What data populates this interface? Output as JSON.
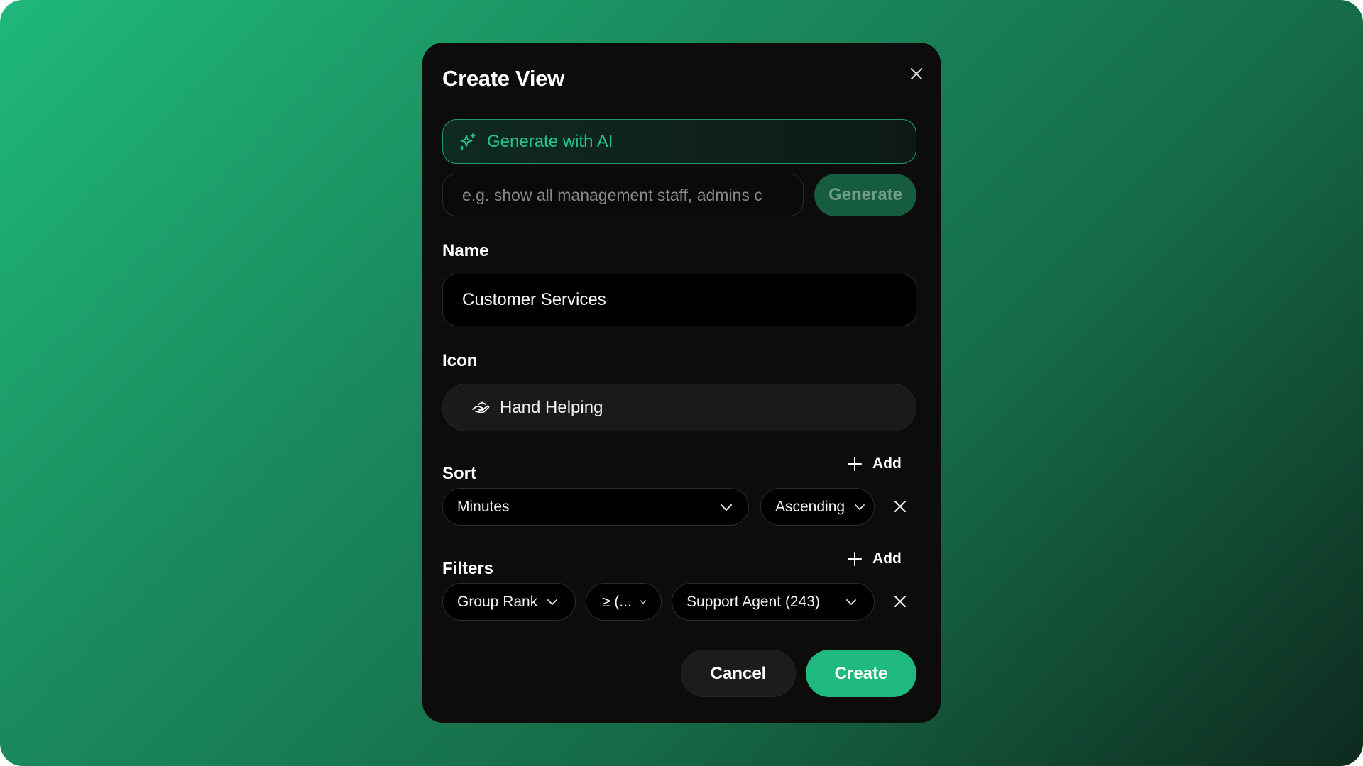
{
  "modal": {
    "title": "Create View",
    "close_icon": "x-icon"
  },
  "ai": {
    "label": "Generate with AI",
    "icon": "sparkles-icon",
    "prompt_placeholder": "e.g. show all management staff, admins c",
    "prompt_value": "",
    "generate_label": "Generate"
  },
  "name": {
    "label": "Name",
    "value": "Customer Services"
  },
  "icon_field": {
    "label": "Icon",
    "selected": "Hand Helping",
    "icon": "hand-helping-icon"
  },
  "sort": {
    "label": "Sort",
    "add_label": "Add",
    "field": "Minutes",
    "direction": "Ascending"
  },
  "filters": {
    "label": "Filters",
    "add_label": "Add",
    "field": "Group Rank",
    "operator": "≥ (...",
    "value": "Support Agent (243)"
  },
  "footer": {
    "cancel_label": "Cancel",
    "create_label": "Create"
  },
  "colors": {
    "accent": "#1fb97f",
    "modal_bg": "#0c0c0c"
  }
}
